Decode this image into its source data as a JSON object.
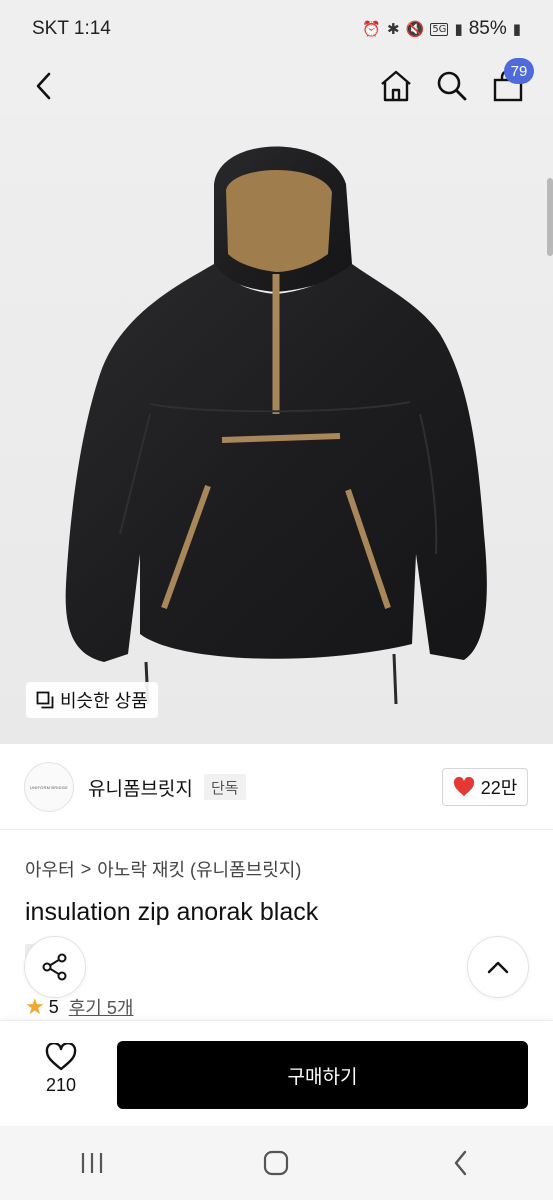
{
  "status_bar": {
    "carrier_time": "SKT 1:14",
    "network": "5G",
    "battery": "85%"
  },
  "header": {
    "cart_count": "79"
  },
  "product_image": {
    "similar_label": "비슷한 상품"
  },
  "brand": {
    "logo_text": "UNIFORM BRIDGE",
    "name": "유니폼브릿지",
    "exclusive_label": "단독",
    "likes": "22만"
  },
  "breadcrumb": {
    "category": "아우터",
    "separator": ">",
    "subcategory": "아노락 재킷 (유니폼브릿지)"
  },
  "product": {
    "title": "insulation zip anorak black",
    "rating": "5",
    "review_label": "후기 5개"
  },
  "purchase": {
    "wish_count": "210",
    "buy_label": "구매하기"
  },
  "colors": {
    "accent": "#4f6bd9",
    "heart": "#e53935",
    "star": "#f1a62c",
    "button": "#000000"
  }
}
